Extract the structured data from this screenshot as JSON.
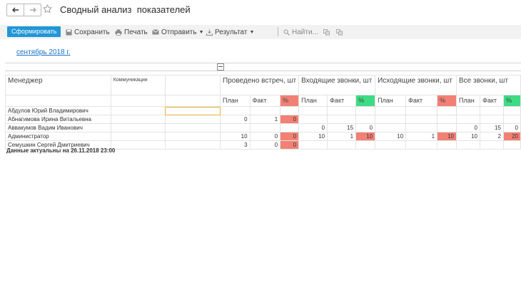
{
  "window": {
    "title": "Сводный анализ  показателей"
  },
  "toolbar": {
    "generate_label": "Сформировать",
    "save_label": "Сохранить",
    "print_label": "Печать",
    "send_label": "Отправить",
    "result_label": "Результат",
    "find_label": "Найти..."
  },
  "period_link": "сентябрь 2018 г.",
  "table": {
    "manager_header": "Менеджер",
    "communications_header": "Коммуникации",
    "groups": [
      "Проведено встреч, шт",
      "Входящие звонки, шт",
      "Исходящие звонки, шт",
      "Все звонки, шт"
    ],
    "subheaders": {
      "plan": "План",
      "fact": "Факт",
      "pct": "%"
    },
    "rows": [
      {
        "name": "Абдулов Юрий Владимирович",
        "v": [
          "",
          "",
          "",
          "",
          "",
          "",
          "",
          "",
          "",
          "",
          "",
          ""
        ]
      },
      {
        "name": "Абнагимова Ирина Витальевна",
        "v": [
          "0",
          "1",
          "0",
          "",
          "",
          "",
          "",
          "",
          "",
          "",
          "",
          ""
        ]
      },
      {
        "name": "Аввакумов Вадим Иванович",
        "v": [
          "",
          "",
          "",
          "0",
          "15",
          "0",
          "",
          "",
          "",
          "0",
          "15",
          "0"
        ]
      },
      {
        "name": "Администратор",
        "v": [
          "10",
          "0",
          "0",
          "10",
          "1",
          "10",
          "10",
          "1",
          "10",
          "10",
          "2",
          "20"
        ]
      },
      {
        "name": "Семушкин Сергей Дмитриевич",
        "v": [
          "3",
          "0",
          "0",
          "",
          "",
          "",
          "",
          "",
          "",
          "",
          "",
          ""
        ]
      }
    ]
  },
  "footer": "Данные актуальны на 26.11.2018 23:00",
  "colors": {
    "accent": "#2196d7",
    "pct_red": "#f28074",
    "pct_green": "#3ddc84",
    "link": "#1a73c7"
  }
}
